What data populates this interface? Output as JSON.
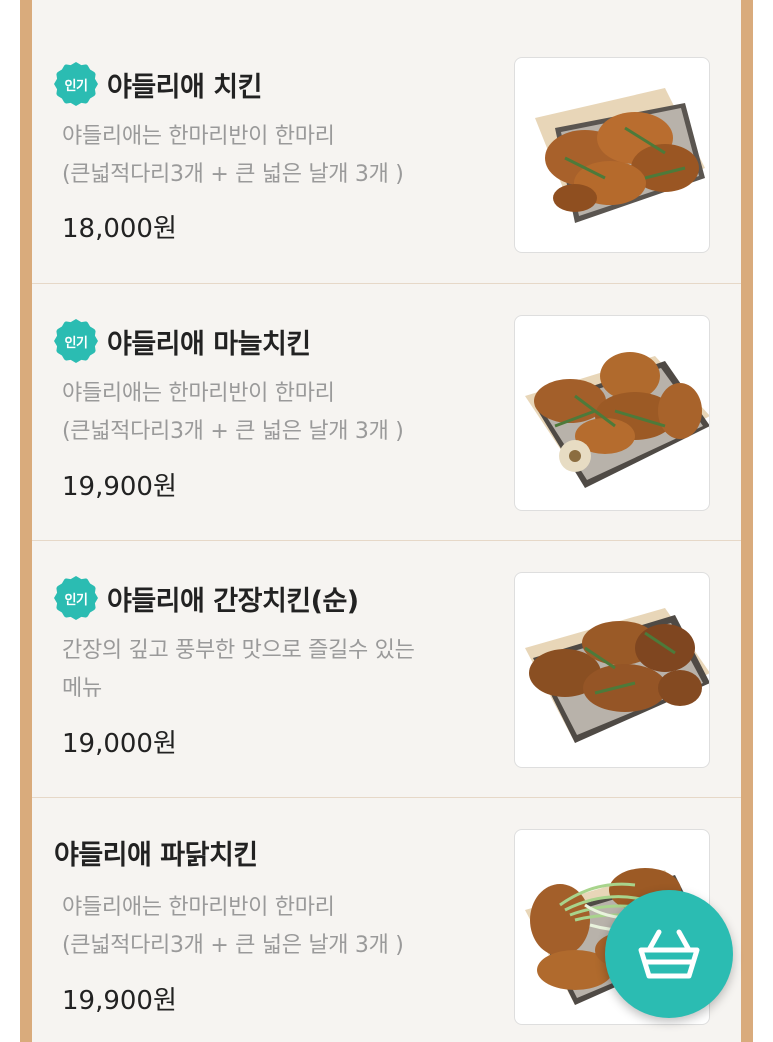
{
  "menu": {
    "items": [
      {
        "badge": "인기",
        "name": "야들리애 치킨",
        "desc_line1": "야들리애는 한마리반이 한마리",
        "desc_line2": "(큰넓적다리3개 + 큰 넓은 날개 3개 )",
        "price": "18,000원",
        "image_icon": "fried-chicken-tray"
      },
      {
        "badge": "인기",
        "name": "야들리애 마늘치킨",
        "desc_line1": "야들리애는 한마리반이 한마리",
        "desc_line2": "(큰넓적다리3개 + 큰 넓은 날개 3개 )",
        "price": "19,900원",
        "image_icon": "garlic-chicken-tray"
      },
      {
        "badge": "인기",
        "name": "야들리애 간장치킨(순)",
        "desc_line1": "간장의 깊고 풍부한 맛으로 즐길수 있는",
        "desc_line2": "메뉴",
        "price": "19,000원",
        "image_icon": "soy-chicken-tray"
      },
      {
        "name": "야들리애 파닭치킨",
        "desc_line1": "야들리애는 한마리반이 한마리",
        "desc_line2": "(큰넓적다리3개 + 큰 넓은 날개 3개 )",
        "price": "19,900원",
        "image_icon": "green-onion-chicken-tray"
      }
    ]
  },
  "cart_button": {
    "icon": "basket-icon"
  },
  "colors": {
    "accent": "#2bbcb2",
    "frame": "#d9ab7c",
    "background": "#f6f4f1"
  }
}
